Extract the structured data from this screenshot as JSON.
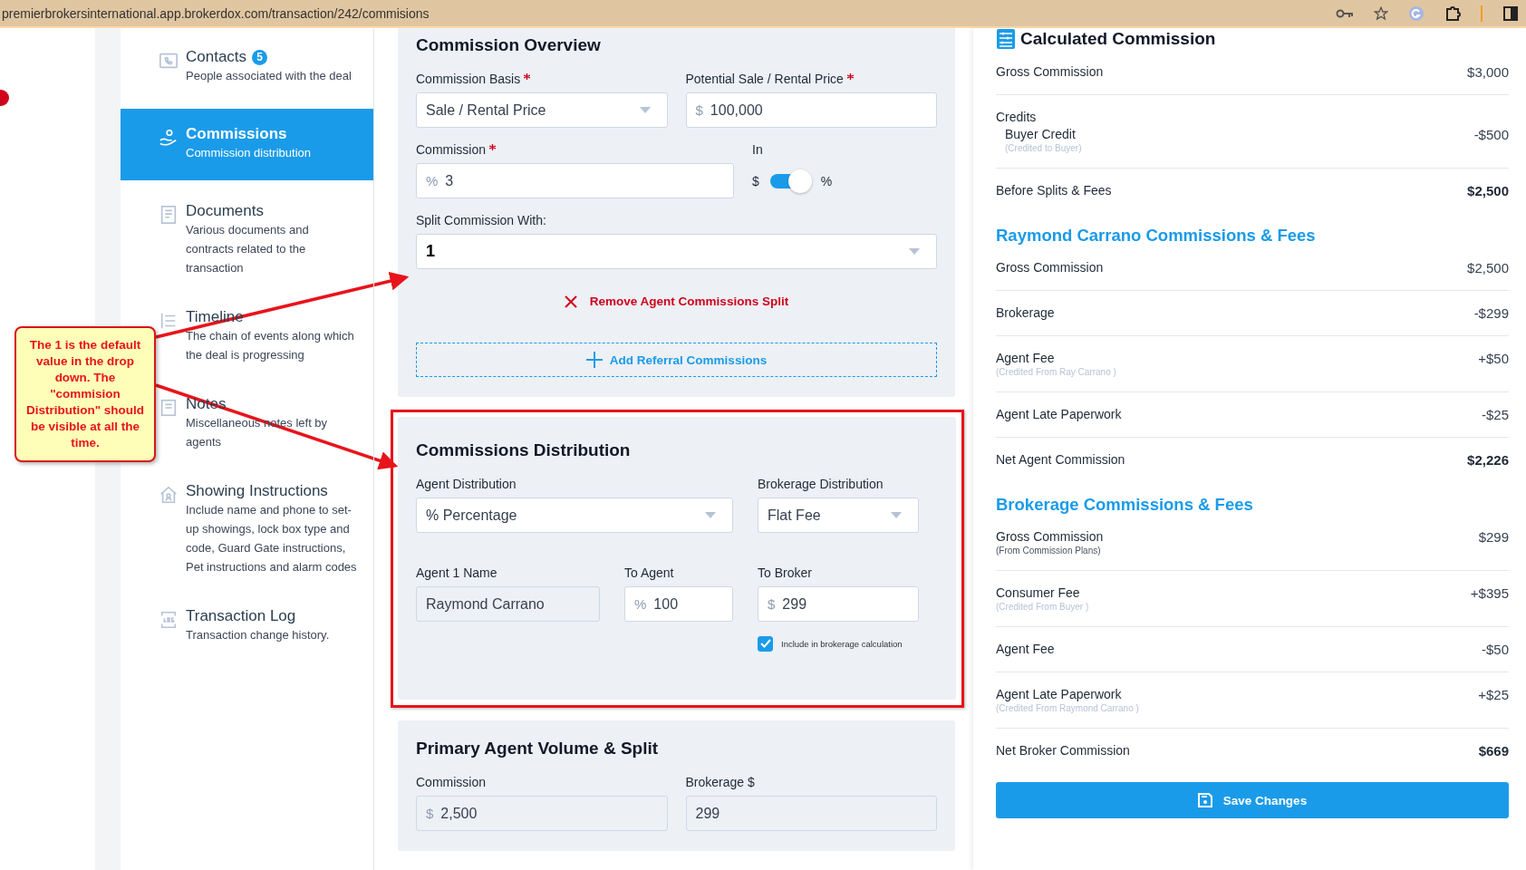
{
  "browser": {
    "url": "premierbrokersinternational.app.brokerdox.com/transaction/242/commisions"
  },
  "sidebar": {
    "items": [
      {
        "title": "Contacts",
        "badge": "5",
        "description": "People associated with the deal",
        "selected": false
      },
      {
        "title": "Commissions",
        "description": "Commission distribution",
        "selected": true
      },
      {
        "title": "Documents",
        "description": "Various documents and contracts related to the transaction",
        "selected": false
      },
      {
        "title": "Timeline",
        "description": "The chain of events along which the deal is progressing",
        "selected": false
      },
      {
        "title": "Notes",
        "description": "Miscellaneous notes left by agents",
        "selected": false
      },
      {
        "title": "Showing Instructions",
        "description": "Include name and phone to set-up showings, lock box type and code, Guard Gate instructions, Pet instructions and alarm codes",
        "selected": false
      },
      {
        "title": "Transaction Log",
        "description": "Transaction change history.",
        "selected": false
      }
    ]
  },
  "overview": {
    "title": "Commission Overview",
    "basis": {
      "label": "Commission Basis",
      "required": true,
      "kind": "select",
      "value": "Sale / Rental Price",
      "readonly": false
    },
    "price": {
      "label": "Potential Sale / Rental Price",
      "required": true,
      "kind": "input",
      "prefix": "$",
      "value": "100,000",
      "readonly": false
    },
    "commission": {
      "label": "Commission",
      "required": true,
      "kind": "input",
      "prefix": "%",
      "value": "3",
      "readonly": false
    },
    "toggle": {
      "label": "In",
      "left": "$",
      "right": "%",
      "on": true
    },
    "split": {
      "label": "Split Commission With:",
      "required": false,
      "kind": "select",
      "value": "1",
      "readonly": false
    },
    "remove_link": "Remove Agent Commissions Split",
    "add_button": "Add Referral Commissions"
  },
  "distribution": {
    "title": "Commissions Distribution",
    "agent_distribution": {
      "label": "Agent Distribution",
      "required": false,
      "kind": "select",
      "value": "% Percentage",
      "readonly": false
    },
    "brokerage_distribution": {
      "label": "Brokerage Distribution",
      "required": false,
      "kind": "select",
      "value": "Flat Fee",
      "readonly": false
    },
    "agent_name": {
      "label": "Agent 1 Name",
      "required": false,
      "kind": "input",
      "value": "Raymond Carrano",
      "readonly": true
    },
    "to_agent": {
      "label": "To Agent",
      "required": false,
      "kind": "input",
      "prefix": "%",
      "value": "100",
      "readonly": false
    },
    "to_broker": {
      "label": "To Broker",
      "required": false,
      "kind": "input",
      "prefix": "$",
      "value": "299",
      "readonly": false
    },
    "include_checkbox": {
      "label": "Include in brokerage calculation",
      "checked": true
    }
  },
  "primary": {
    "title": "Primary Agent Volume & Split",
    "commission": {
      "label": "Commission",
      "required": false,
      "kind": "input",
      "prefix": "$",
      "value": "2,500",
      "readonly": true
    },
    "brokerage": {
      "label": "Brokerage $",
      "required": false,
      "kind": "input",
      "value": "299",
      "readonly": true
    }
  },
  "calculated": {
    "title": "Calculated Commission",
    "rows": [
      {
        "kind": "line",
        "label": "Gross Commission",
        "value": "$3,000"
      },
      {
        "kind": "group",
        "label": "Credits",
        "items": [
          {
            "label": "Buyer Credit",
            "note": "(Credited to Buyer)",
            "note_muted": true,
            "value": "-$500"
          }
        ]
      },
      {
        "kind": "total",
        "label": "Before Splits & Fees",
        "value": "$2,500"
      }
    ],
    "sections": [
      {
        "title": "Raymond Carrano Commissions & Fees",
        "rows": [
          {
            "kind": "line",
            "label": "Gross Commission",
            "value": "$2,500"
          },
          {
            "kind": "line",
            "label": "Brokerage",
            "value": "-$299"
          },
          {
            "kind": "line",
            "label": "Agent Fee",
            "note": "(Credited From Ray Carrano )",
            "note_muted": true,
            "value": "+$50"
          },
          {
            "kind": "line",
            "label": "Agent Late Paperwork",
            "value": "-$25"
          },
          {
            "kind": "total",
            "label": "Net Agent Commission",
            "value": "$2,226"
          }
        ]
      },
      {
        "title": "Brokerage Commissions & Fees",
        "rows": [
          {
            "kind": "line",
            "label": "Gross Commission",
            "note": "(From Commission Plans)",
            "note_muted": false,
            "value": "$299"
          },
          {
            "kind": "line",
            "label": "Consumer Fee",
            "note": "(Credited From Buyer )",
            "note_muted": true,
            "value": "+$395"
          },
          {
            "kind": "line",
            "label": "Agent Fee",
            "value": "-$50"
          },
          {
            "kind": "line",
            "label": "Agent Late Paperwork",
            "note": "(Credited From Raymond Carrano )",
            "note_muted": true,
            "value": "+$25"
          },
          {
            "kind": "total",
            "label": "Net Broker Commission",
            "value": "$669"
          }
        ]
      }
    ],
    "save_button": "Save Changes"
  },
  "annotation": {
    "text": "The 1 is the default value in the drop down. The \"commision Distribution\" should be visible at all the time."
  }
}
